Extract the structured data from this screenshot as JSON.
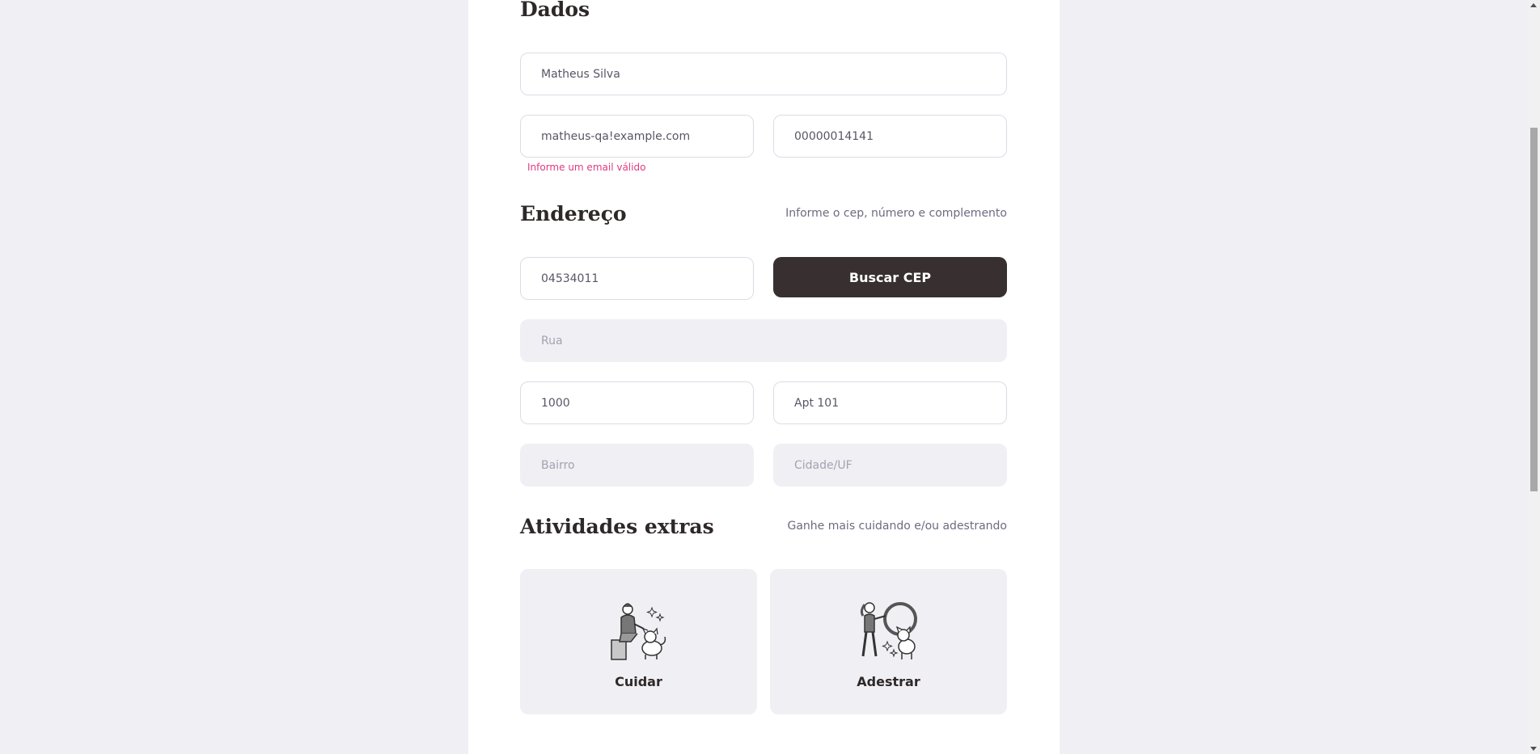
{
  "sections": {
    "dados": {
      "title": "Dados"
    },
    "endereco": {
      "title": "Endereço",
      "hint": "Informe o cep, número e complemento"
    },
    "atividades": {
      "title": "Atividades extras",
      "hint": "Ganhe mais cuidando e/ou adestrando"
    }
  },
  "fields": {
    "name": {
      "value": "Matheus Silva"
    },
    "email": {
      "value": "matheus-qa!example.com",
      "error": "Informe um email válido"
    },
    "cpf": {
      "value": "00000014141"
    },
    "cep": {
      "value": "04534011"
    },
    "rua": {
      "placeholder": "Rua"
    },
    "numero": {
      "value": "1000"
    },
    "complemento": {
      "value": "Apt 101"
    },
    "bairro": {
      "placeholder": "Bairro"
    },
    "cidade": {
      "placeholder": "Cidade/UF"
    }
  },
  "buttons": {
    "buscar_cep": "Buscar CEP"
  },
  "activities": [
    {
      "label": "Cuidar",
      "icon": "pet-care-icon"
    },
    {
      "label": "Adestrar",
      "icon": "pet-training-icon"
    }
  ],
  "colors": {
    "background": "#f0eff4",
    "panel": "#ffffff",
    "heading": "#2e2828",
    "button": "#383030",
    "error": "#de3b80"
  }
}
